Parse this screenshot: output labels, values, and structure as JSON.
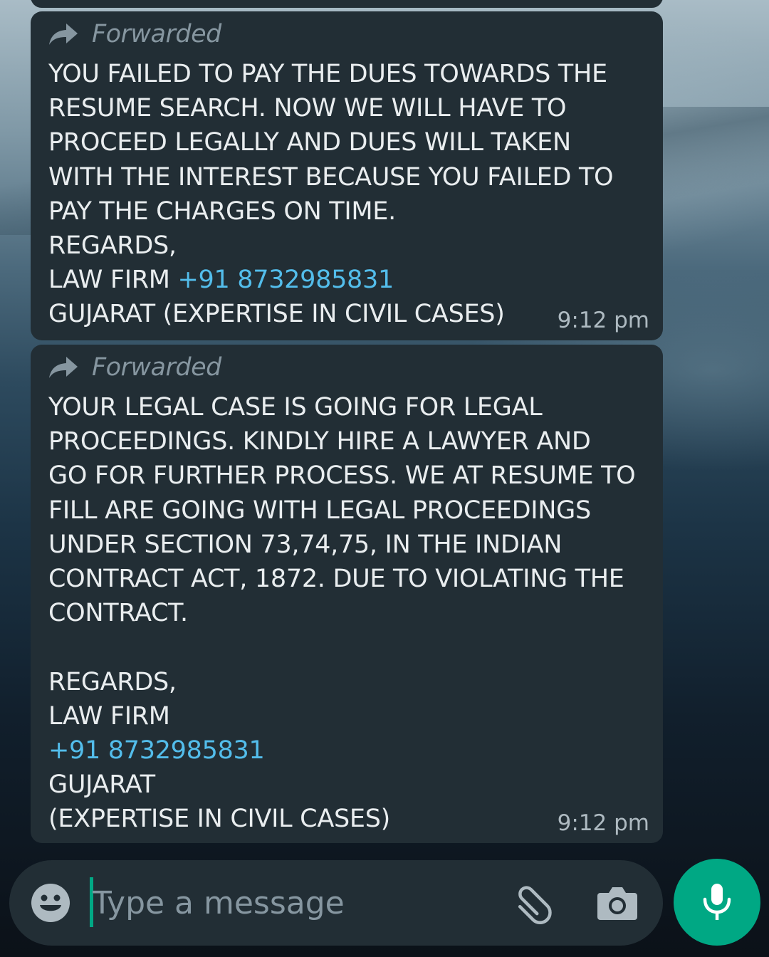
{
  "messages": [
    {
      "forwarded_label": "Forwarded",
      "lines": [
        {
          "text": "YOU FAILED TO PAY THE DUES TOWARDS THE"
        },
        {
          "text": "RESUME SEARCH. NOW WE WILL HAVE TO"
        },
        {
          "text": "PROCEED LEGALLY AND DUES WILL TAKEN"
        },
        {
          "text": "WITH THE INTEREST BECAUSE YOU FAILED TO"
        },
        {
          "text": "PAY THE CHARGES ON TIME."
        },
        {
          "text": "REGARDS,"
        },
        {
          "text": "LAW FIRM ",
          "phone": "+91 8732985831"
        },
        {
          "text": "GUJARAT (EXPERTISE IN CIVIL CASES)"
        }
      ],
      "time": "9:12 pm"
    },
    {
      "forwarded_label": "Forwarded",
      "lines": [
        {
          "text": "YOUR LEGAL CASE IS GOING FOR LEGAL"
        },
        {
          "text": "PROCEEDINGS. KINDLY HIRE A LAWYER AND"
        },
        {
          "text": "GO FOR FURTHER PROCESS. WE AT RESUME TO"
        },
        {
          "text": "FILL ARE GOING WITH LEGAL PROCEEDINGS"
        },
        {
          "text": "UNDER SECTION 73,74,75, IN THE INDIAN"
        },
        {
          "text": "CONTRACT ACT, 1872. DUE TO VIOLATING THE"
        },
        {
          "text": "CONTRACT."
        },
        {
          "text": ""
        },
        {
          "text": "REGARDS,"
        },
        {
          "text": "LAW FIRM"
        },
        {
          "text": "",
          "phone": "+91 8732985831"
        },
        {
          "text": "GUJARAT"
        },
        {
          "text": "(EXPERTISE IN CIVIL CASES)"
        }
      ],
      "time": "9:12 pm"
    }
  ],
  "composer": {
    "placeholder": "Type a message",
    "emoji_icon": "emoji-icon",
    "attach_icon": "paperclip-icon",
    "camera_icon": "camera-icon",
    "mic_icon": "mic-icon"
  },
  "colors": {
    "bubble": "#222e35",
    "text": "#e9edef",
    "meta": "#8696a0",
    "link": "#53bdeb",
    "accent": "#00a884"
  }
}
